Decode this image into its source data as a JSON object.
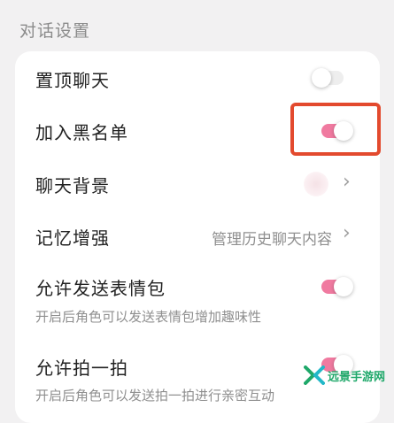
{
  "section": {
    "title": "对话设置"
  },
  "rows": {
    "pin_chat": {
      "label": "置顶聊天",
      "toggle_on": false
    },
    "blacklist": {
      "label": "加入黑名单",
      "toggle_on": true
    },
    "chat_background": {
      "label": "聊天背景"
    },
    "memory_enhance": {
      "label": "记忆增强",
      "hint": "管理历史聊天内容"
    },
    "allow_stickers": {
      "label": "允许发送表情包",
      "desc": "开启后角色可以发送表情包增加趣味性",
      "toggle_on": true
    },
    "allow_nudge": {
      "label": "允许拍一拍",
      "desc": "开启后角色可以发送拍一拍进行亲密互动",
      "toggle_on": true
    }
  },
  "colors": {
    "toggle_on": "#f07aa0",
    "highlight": "#e34a2e",
    "watermark": "#1fa86a"
  },
  "watermark": {
    "text": "远景手游网"
  },
  "icons": {
    "chevron": "chevron-right-icon"
  }
}
